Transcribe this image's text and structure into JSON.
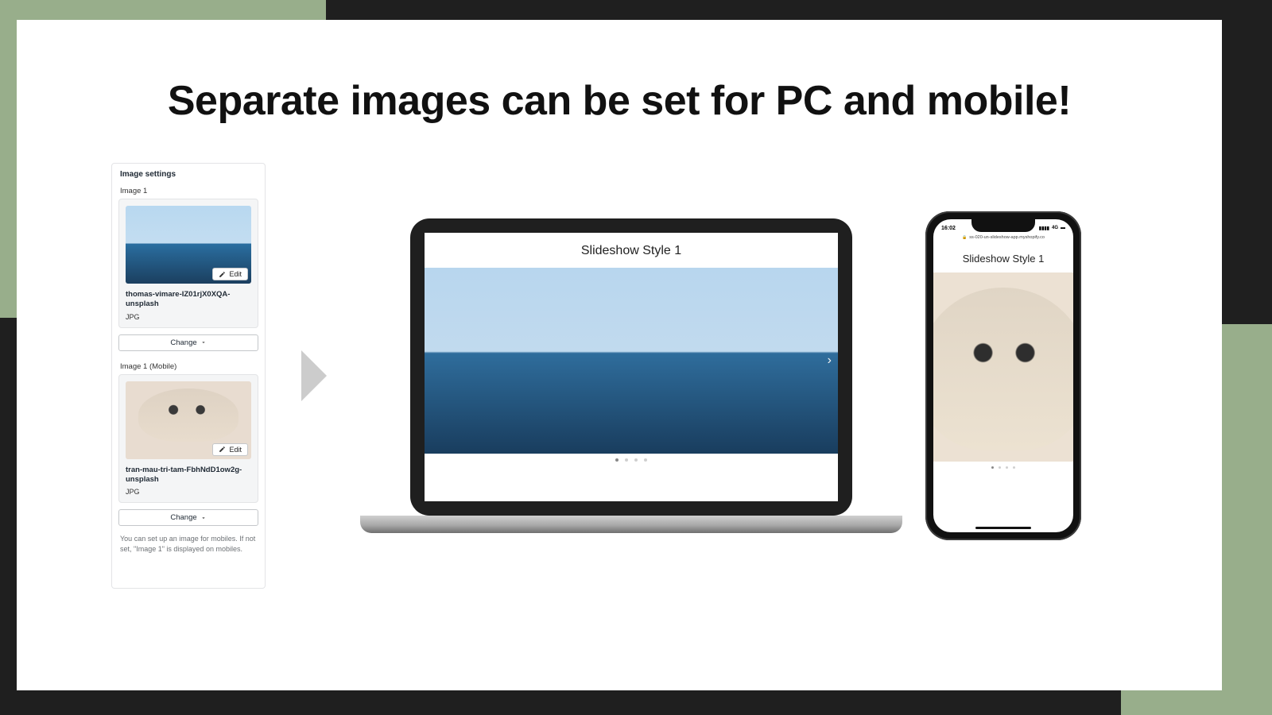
{
  "headline": "Separate images can be set for PC and mobile!",
  "panel": {
    "title": "Image settings",
    "image1": {
      "label": "Image 1",
      "edit": "Edit",
      "filename": "thomas-vimare-IZ01rjX0XQA-unsplash",
      "filetype": "JPG",
      "change": "Change"
    },
    "image1_mobile": {
      "label": "Image 1 (Mobile)",
      "edit": "Edit",
      "filename": "tran-mau-tri-tam-FbhNdD1ow2g-unsplash",
      "filetype": "JPG",
      "change": "Change"
    },
    "help": "You can set up an image for mobiles. If not set, \"Image 1\" is displayed on mobiles."
  },
  "laptop": {
    "title": "Slideshow Style 1"
  },
  "phone": {
    "time": "16:02",
    "signal": "4G",
    "url": "ss-020-un-slideshow-app.myshopify.co",
    "title": "Slideshow Style 1"
  }
}
